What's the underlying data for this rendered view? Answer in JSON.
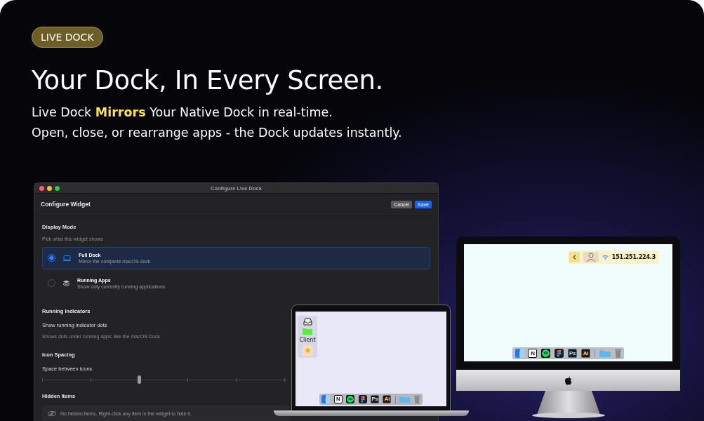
{
  "badge": "LIVE DOCK",
  "headline": "Your Dock, In Every Screen.",
  "tagline": [
    "Live Dock **Mirrors** Your Native Dock in real-time.",
    "Open, close, or rearrange apps - the Dock updates instantly."
  ],
  "settings_window": {
    "title": "Configure Live Dock",
    "header": "Configure Widget",
    "buttons": [
      {
        "label": "Cancel",
        "kind": "secondary"
      },
      {
        "label": "Save",
        "kind": "primary"
      }
    ],
    "display_mode": {
      "heading": "Display Mode",
      "hint": "Pick what this widget shows",
      "options": [
        {
          "title": "Full Dock",
          "description": "Mirror the complete macOS dock",
          "kind": "laptop",
          "selected": true
        },
        {
          "title": "Running Apps",
          "description": "Show only currently running applications",
          "kind": "stack",
          "selected": false
        }
      ]
    },
    "running_indicators": {
      "heading": "Running Indicators",
      "label": "Show running indicator dots",
      "description": "Shows dots under running apps, like the macOS Dock"
    },
    "icon_spacing": {
      "heading": "Icon Spacing",
      "label": "Space between icons",
      "level": 0.25
    },
    "hidden_items": {
      "heading": "Hidden Items",
      "message": "No hidden items. Right-click any item in the widget to hide it."
    }
  },
  "laptop": {
    "sidebar": [
      {
        "kind": "tray"
      },
      {
        "kind": "folder",
        "label": "Client"
      },
      {
        "kind": "emoji"
      }
    ],
    "dock": [
      {
        "kind": "finder"
      },
      {
        "kind": "lettered",
        "glyph": "N",
        "color": "#ffffff"
      },
      {
        "kind": "spotify"
      },
      {
        "kind": "figma"
      },
      {
        "kind": "lettered",
        "glyph": "Ps",
        "color": "#0b1f33"
      },
      {
        "kind": "lettered",
        "glyph": "Ai",
        "color": "#2e1a00"
      },
      {
        "kind": "divider"
      },
      {
        "kind": "folder"
      },
      {
        "kind": "trash"
      }
    ]
  },
  "desktop": {
    "widget": {
      "address": "151.251.224.3"
    },
    "dock": [
      {
        "kind": "finder"
      },
      {
        "kind": "lettered",
        "glyph": "N",
        "color": "#ffffff"
      },
      {
        "kind": "spotify"
      },
      {
        "kind": "figma"
      },
      {
        "kind": "lettered",
        "glyph": "Ps",
        "color": "#0b1f33"
      },
      {
        "kind": "lettered",
        "glyph": "Ai",
        "color": "#2e1a00"
      },
      {
        "kind": "divider"
      },
      {
        "kind": "folder"
      },
      {
        "kind": "trash"
      }
    ]
  }
}
